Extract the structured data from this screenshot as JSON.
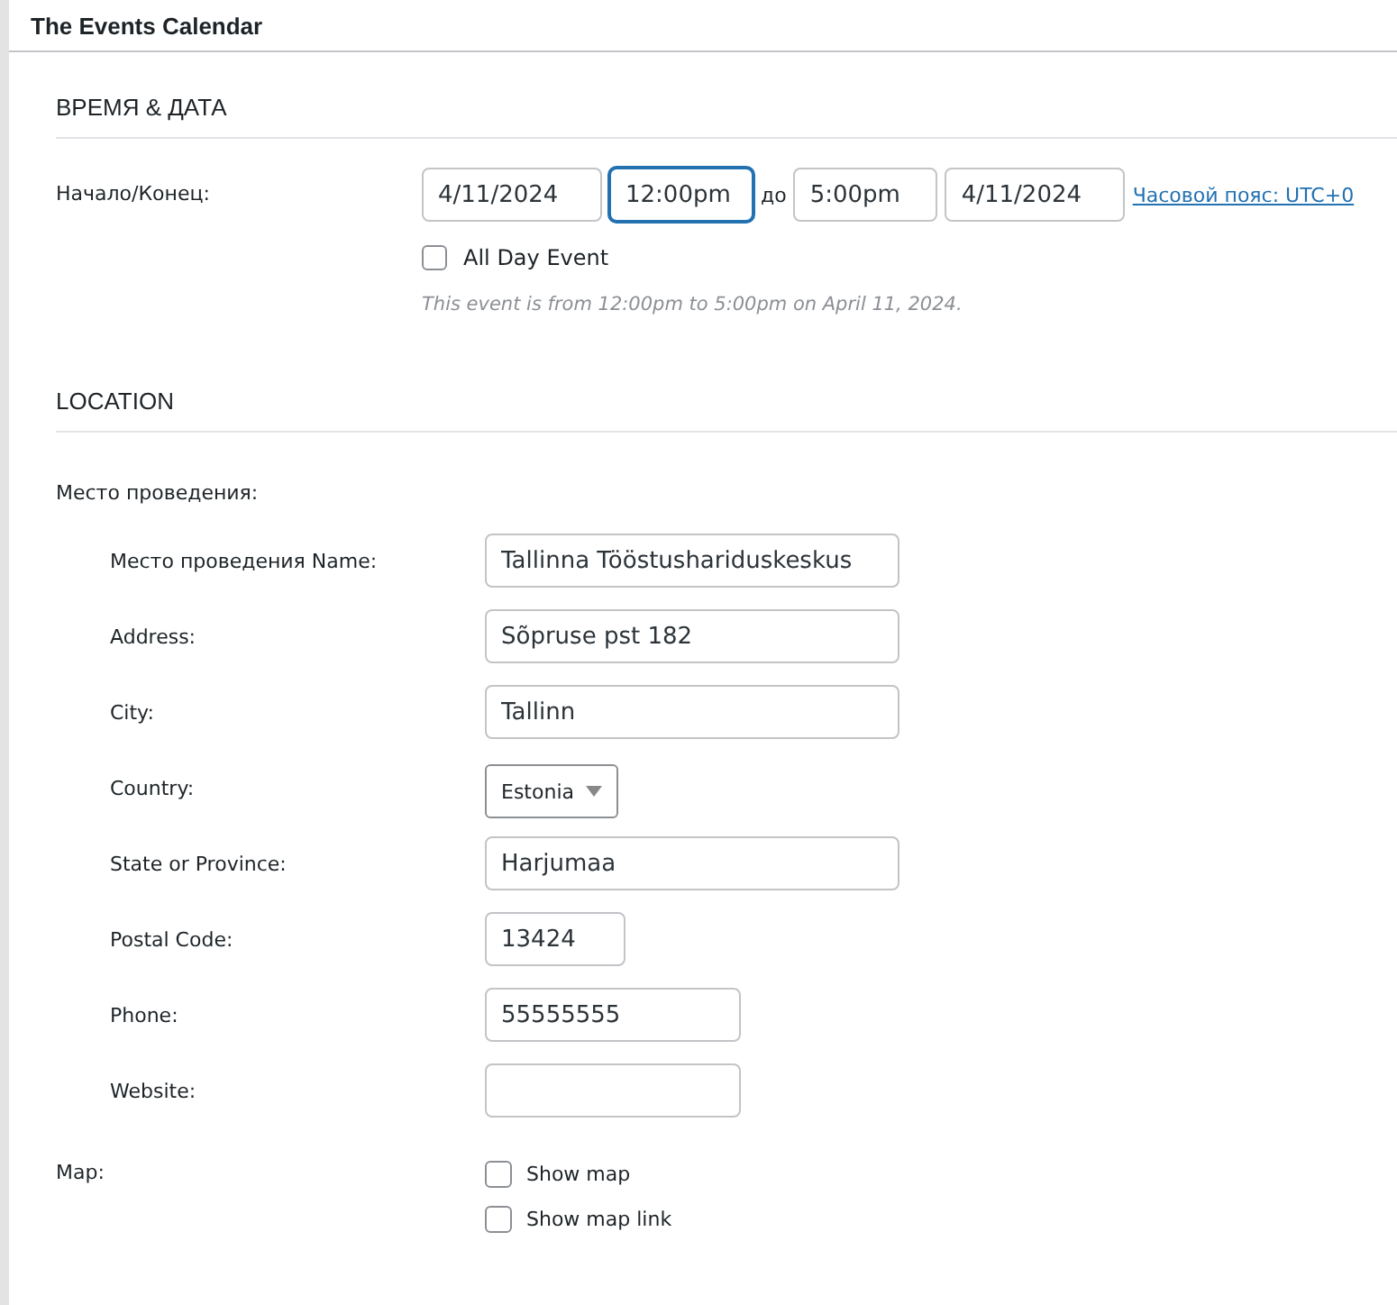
{
  "panel": {
    "title": "The Events Calendar"
  },
  "datetime": {
    "heading": "ВРЕМЯ & ДАТА",
    "label": "Начало/Конец:",
    "start_date": {
      "value": "4/11/2024",
      "focused": false
    },
    "start_time": {
      "value": "12:00pm",
      "focused": true
    },
    "separator": "до",
    "end_time": {
      "value": "5:00pm",
      "focused": false
    },
    "end_date": {
      "value": "4/11/2024",
      "focused": false
    },
    "timezone_link": "Часовой пояс: UTC+0",
    "all_day": {
      "label": "All Day Event",
      "checked": false
    },
    "summary": "This event is from 12:00pm to 5:00pm on April 11, 2024."
  },
  "location": {
    "heading": "LOCATION",
    "venue_label": "Место проведения:",
    "fields": [
      {
        "label": "Место проведения Name:",
        "kind": "text",
        "value": "Tallinna Tööstushariduskeskus"
      },
      {
        "label": "Address:",
        "kind": "text",
        "value": "Sõpruse pst 182"
      },
      {
        "label": "City:",
        "kind": "text",
        "value": "Tallinn"
      },
      {
        "label": "Country:",
        "kind": "select",
        "value": "Estonia"
      },
      {
        "label": "State or Province:",
        "kind": "text",
        "value": "Harjumaa"
      },
      {
        "label": "Postal Code:",
        "kind": "text",
        "value": "13424"
      },
      {
        "label": "Phone:",
        "kind": "text",
        "value": "55555555"
      },
      {
        "label": "Website:",
        "kind": "text"
      }
    ],
    "map_label": "Map:",
    "map_options": [
      {
        "label": "Show map",
        "checked": false
      },
      {
        "label": "Show map link",
        "checked": false
      }
    ]
  }
}
